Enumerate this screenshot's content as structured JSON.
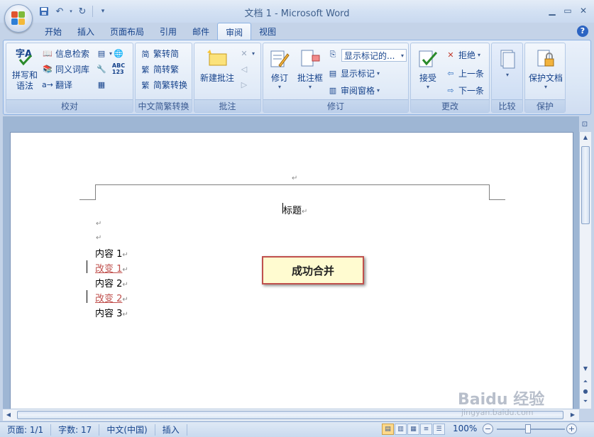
{
  "window": {
    "title": "文档 1 - Microsoft Word",
    "controls": [
      "minimize",
      "maximize",
      "close"
    ]
  },
  "quick_access": {
    "items": [
      {
        "name": "save-icon",
        "glyph": "💾"
      },
      {
        "name": "undo-icon",
        "glyph": "↶"
      },
      {
        "name": "redo-icon",
        "glyph": "↻"
      },
      {
        "name": "customize-qat-icon",
        "glyph": "▾"
      }
    ]
  },
  "tabs": [
    {
      "label": "开始",
      "active": false
    },
    {
      "label": "插入",
      "active": false
    },
    {
      "label": "页面布局",
      "active": false
    },
    {
      "label": "引用",
      "active": false
    },
    {
      "label": "邮件",
      "active": false
    },
    {
      "label": "审阅",
      "active": true
    },
    {
      "label": "视图",
      "active": false
    }
  ],
  "ribbon": {
    "proofing": {
      "label": "校对",
      "spelling": "拼写和\n语法",
      "research": "信息检索",
      "thesaurus": "同义词库",
      "translate": "翻译"
    },
    "chinese_conversion": {
      "label": "中文简繁转换",
      "to_traditional": "繁转简",
      "to_simplified": "简转繁",
      "convert": "简繁转换"
    },
    "comments": {
      "label": "批注",
      "new_comment": "新建批注"
    },
    "tracking": {
      "label": "修订",
      "track_changes": "修订",
      "balloons": "批注框",
      "display_dropdown": "显示标记的...",
      "show_markup": "显示标记",
      "reviewing_pane": "审阅窗格"
    },
    "changes": {
      "label": "更改",
      "accept": "接受",
      "reject": "拒绝",
      "previous": "上一条",
      "next": "下一条"
    },
    "compare": {
      "label": "比较"
    },
    "protect": {
      "label": "保护",
      "protect_document": "保护文档"
    }
  },
  "document": {
    "header_mark": "↵",
    "title": "标题",
    "lines": [
      {
        "text": "↵",
        "type": "empty"
      },
      {
        "text": "↵",
        "type": "empty"
      },
      {
        "text": "内容 1",
        "type": "normal"
      },
      {
        "text": "改变 1",
        "type": "changed"
      },
      {
        "text": "内容 2",
        "type": "normal"
      },
      {
        "text": "改变 2",
        "type": "changed"
      },
      {
        "text": "内容 3",
        "type": "normal"
      }
    ],
    "callout": "成功合并"
  },
  "statusbar": {
    "page": "页面: 1/1",
    "words": "字数: 17",
    "language": "中文(中国)",
    "mode": "插入",
    "zoom": "100%"
  },
  "watermark": {
    "brand": "Baidu 经验",
    "url": "jingyan.baidu.com"
  },
  "colors": {
    "accent": "#15428b",
    "change": "#c0504d",
    "callout_bg": "#fffbd0"
  }
}
